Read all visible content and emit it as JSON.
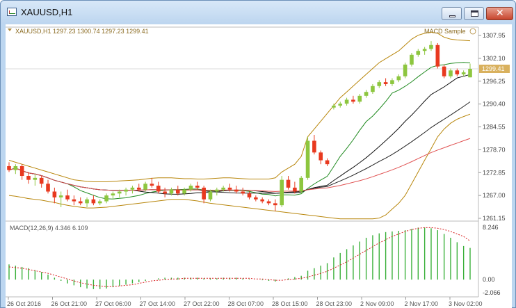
{
  "window": {
    "title": "XAUUSD,H1",
    "close_glyph": "✕",
    "icons": [
      "chart-icon",
      "minimize-icon",
      "maximize-icon",
      "close-icon"
    ]
  },
  "main_chart": {
    "header": "XAUUSD,H1  1297.23 1300.74 1297.23 1299.41",
    "indicator_label": "MACD Sample",
    "price_tag": "1299.41",
    "price_tag_color": "#d9b15e",
    "bull_color": "#8dc63f",
    "bear_color": "#e8391f",
    "band_color": "#b8860b",
    "price_axis": [
      "1307.95",
      "1302.10",
      "1296.25",
      "1290.40",
      "1284.55",
      "1278.70",
      "1272.85",
      "1267.00",
      "1261.15"
    ]
  },
  "macd": {
    "header": "MACD(12,26,9) 4.346 6.109",
    "axis": [
      "8.246",
      "0.00",
      "-2.066"
    ],
    "hist_color": "#3ab03a",
    "signal_color": "#d82020"
  },
  "time_axis": [
    "26 Oct 2016",
    "26 Oct 21:00",
    "27 Oct 06:00",
    "27 Oct 14:00",
    "27 Oct 22:00",
    "28 Oct 07:00",
    "28 Oct 15:00",
    "28 Oct 23:00",
    "2 Nov 09:00",
    "2 Nov 17:00",
    "3 Nov 02:00"
  ],
  "chart_data": {
    "type": "candlestick",
    "symbol": "XAUUSD",
    "timeframe": "H1",
    "ohlc_last": {
      "open": 1297.23,
      "high": 1300.74,
      "low": 1297.23,
      "close": 1299.41
    },
    "ylim": [
      1261.15,
      1307.95
    ],
    "candles": [
      [
        1274.5,
        1275.5,
        1273.0,
        1273.5
      ],
      [
        1273.5,
        1275.0,
        1272.5,
        1274.5
      ],
      [
        1274.5,
        1275.0,
        1271.0,
        1272.0
      ],
      [
        1272.0,
        1273.0,
        1270.0,
        1271.0
      ],
      [
        1271.0,
        1272.5,
        1269.5,
        1271.5
      ],
      [
        1271.5,
        1272.0,
        1269.0,
        1270.0
      ],
      [
        1270.0,
        1271.0,
        1267.5,
        1268.0
      ],
      [
        1268.0,
        1269.0,
        1265.0,
        1266.5
      ],
      [
        1266.5,
        1268.0,
        1264.0,
        1267.0
      ],
      [
        1267.0,
        1268.5,
        1265.5,
        1266.0
      ],
      [
        1266.0,
        1267.0,
        1264.5,
        1265.5
      ],
      [
        1265.5,
        1266.5,
        1264.5,
        1265.0
      ],
      [
        1265.0,
        1266.5,
        1264.0,
        1266.0
      ],
      [
        1266.0,
        1267.0,
        1264.5,
        1265.0
      ],
      [
        1265.0,
        1266.0,
        1264.5,
        1265.5
      ],
      [
        1265.5,
        1267.5,
        1265.0,
        1267.0
      ],
      [
        1267.0,
        1268.0,
        1266.0,
        1267.5
      ],
      [
        1267.5,
        1268.5,
        1266.5,
        1268.0
      ],
      [
        1268.0,
        1269.0,
        1267.0,
        1268.5
      ],
      [
        1268.5,
        1269.5,
        1267.5,
        1269.0
      ],
      [
        1269.0,
        1270.0,
        1268.0,
        1268.5
      ],
      [
        1268.5,
        1270.5,
        1268.0,
        1270.0
      ],
      [
        1270.0,
        1271.5,
        1269.0,
        1269.5
      ],
      [
        1269.5,
        1270.5,
        1267.5,
        1268.0
      ],
      [
        1268.0,
        1269.0,
        1266.5,
        1267.5
      ],
      [
        1267.5,
        1269.0,
        1267.0,
        1268.5
      ],
      [
        1268.5,
        1269.5,
        1267.0,
        1267.5
      ],
      [
        1267.5,
        1269.0,
        1267.0,
        1268.5
      ],
      [
        1268.5,
        1270.0,
        1268.0,
        1269.5
      ],
      [
        1269.5,
        1270.5,
        1268.5,
        1269.0
      ],
      [
        1269.0,
        1269.5,
        1265.0,
        1266.0
      ],
      [
        1266.0,
        1268.5,
        1265.5,
        1268.0
      ],
      [
        1268.0,
        1269.0,
        1267.0,
        1268.5
      ],
      [
        1268.5,
        1269.5,
        1268.0,
        1269.0
      ],
      [
        1269.0,
        1270.0,
        1268.0,
        1268.5
      ],
      [
        1268.5,
        1269.5,
        1267.5,
        1268.0
      ],
      [
        1268.0,
        1269.0,
        1267.0,
        1267.5
      ],
      [
        1267.5,
        1268.0,
        1266.0,
        1266.5
      ],
      [
        1266.5,
        1267.0,
        1265.5,
        1266.0
      ],
      [
        1266.0,
        1266.5,
        1265.0,
        1265.5
      ],
      [
        1265.5,
        1266.0,
        1264.5,
        1265.0
      ],
      [
        1265.0,
        1266.0,
        1263.0,
        1264.5
      ],
      [
        1264.5,
        1272.0,
        1264.0,
        1271.0
      ],
      [
        1271.0,
        1272.0,
        1268.5,
        1269.0
      ],
      [
        1269.0,
        1270.5,
        1267.5,
        1268.0
      ],
      [
        1268.0,
        1272.0,
        1267.5,
        1271.5
      ],
      [
        1271.5,
        1282.0,
        1271.0,
        1281.0
      ],
      [
        1281.0,
        1282.5,
        1277.5,
        1278.0
      ],
      [
        1278.0,
        1278.5,
        1275.0,
        1276.0
      ],
      [
        1276.0,
        1276.5,
        1274.5,
        1275.0
      ],
      [
        1289.5,
        1290.5,
        1289.0,
        1290.0
      ],
      [
        1290.0,
        1291.0,
        1289.5,
        1290.5
      ],
      [
        1290.5,
        1292.0,
        1290.0,
        1291.5
      ],
      [
        1291.5,
        1292.5,
        1290.5,
        1291.0
      ],
      [
        1291.0,
        1293.0,
        1290.5,
        1292.5
      ],
      [
        1292.5,
        1294.0,
        1292.0,
        1293.5
      ],
      [
        1293.5,
        1295.5,
        1293.0,
        1295.0
      ],
      [
        1295.0,
        1296.5,
        1294.5,
        1296.0
      ],
      [
        1296.0,
        1297.0,
        1295.0,
        1295.5
      ],
      [
        1295.5,
        1297.0,
        1295.0,
        1296.5
      ],
      [
        1296.5,
        1298.0,
        1296.0,
        1297.5
      ],
      [
        1297.5,
        1301.0,
        1297.0,
        1300.5
      ],
      [
        1300.5,
        1303.5,
        1300.0,
        1303.0
      ],
      [
        1303.0,
        1304.5,
        1302.5,
        1304.0
      ],
      [
        1304.0,
        1305.0,
        1303.0,
        1304.5
      ],
      [
        1304.5,
        1306.5,
        1304.0,
        1305.5
      ],
      [
        1305.5,
        1306.0,
        1299.5,
        1300.0
      ],
      [
        1300.0,
        1300.5,
        1297.0,
        1297.5
      ],
      [
        1297.5,
        1299.5,
        1297.0,
        1299.0
      ],
      [
        1299.0,
        1299.5,
        1297.5,
        1298.0
      ],
      [
        1298.0,
        1299.0,
        1297.5,
        1298.5
      ],
      [
        1297.23,
        1300.74,
        1297.23,
        1299.41
      ]
    ],
    "bollinger_upper": [
      1276,
      1275.5,
      1275,
      1274.5,
      1274,
      1273.5,
      1273,
      1272.5,
      1272,
      1271.5,
      1271,
      1270.8,
      1270.6,
      1270.5,
      1270.5,
      1270.5,
      1270.6,
      1270.7,
      1270.8,
      1270.9,
      1271,
      1271.2,
      1271.4,
      1271.5,
      1271.5,
      1271.5,
      1271.4,
      1271.3,
      1271.3,
      1271.2,
      1271.2,
      1271.3,
      1271.4,
      1271.5,
      1271.5,
      1271.4,
      1271.3,
      1271.2,
      1271.2,
      1271.2,
      1271.2,
      1271.5,
      1273,
      1274,
      1275,
      1277,
      1282,
      1284,
      1286,
      1288,
      1290,
      1292,
      1293.5,
      1295,
      1296.5,
      1298,
      1299.5,
      1301,
      1302,
      1303,
      1304,
      1305.5,
      1307,
      1308,
      1308.5,
      1308.8,
      1308.5,
      1307.5,
      1307,
      1306.8,
      1306.7,
      1306.6
    ],
    "bollinger_lower": [
      1267,
      1266.8,
      1266.5,
      1266.2,
      1266,
      1265.8,
      1265.5,
      1265.2,
      1264.8,
      1264.5,
      1264.2,
      1264,
      1263.8,
      1263.8,
      1263.9,
      1264,
      1264.2,
      1264.4,
      1264.6,
      1264.8,
      1265,
      1265.2,
      1265.4,
      1265.6,
      1265.8,
      1266,
      1266,
      1266,
      1265.8,
      1265.6,
      1265.3,
      1265,
      1264.8,
      1264.6,
      1264.4,
      1264.2,
      1264,
      1263.8,
      1263.6,
      1263.4,
      1263.2,
      1263,
      1262.8,
      1262.6,
      1262.4,
      1262.2,
      1262,
      1261.8,
      1261.6,
      1261.4,
      1261.2,
      1261,
      1261,
      1261,
      1261,
      1261,
      1261,
      1261.2,
      1262,
      1263.5,
      1265,
      1267,
      1270,
      1273,
      1276,
      1279,
      1282,
      1284,
      1285.5,
      1286.5,
      1287.2,
      1287.8
    ],
    "macd_hist": [
      2.4,
      2.2,
      2.0,
      1.8,
      1.5,
      1.2,
      0.8,
      0.3,
      -0.2,
      -0.6,
      -0.9,
      -1.2,
      -1.4,
      -1.5,
      -1.5,
      -1.4,
      -1.2,
      -1.0,
      -0.8,
      -0.6,
      -0.4,
      -0.2,
      0.0,
      0.2,
      0.3,
      0.3,
      0.3,
      0.3,
      0.3,
      0.3,
      0.2,
      0.2,
      0.2,
      0.3,
      0.3,
      0.3,
      0.2,
      0.1,
      0.0,
      -0.1,
      -0.2,
      -0.3,
      0.0,
      0.2,
      0.4,
      0.6,
      1.4,
      1.8,
      2.2,
      2.6,
      3.5,
      4.2,
      4.8,
      5.4,
      6.0,
      6.6,
      7.0,
      7.3,
      7.5,
      7.6,
      7.7,
      7.8,
      8.0,
      8.2,
      8.2,
      8.1,
      7.8,
      7.2,
      6.6,
      5.9,
      5.3,
      5.0
    ],
    "macd_signal": [
      2.0,
      1.9,
      1.8,
      1.6,
      1.4,
      1.2,
      1.0,
      0.7,
      0.4,
      0.1,
      -0.2,
      -0.5,
      -0.7,
      -0.9,
      -1.0,
      -1.1,
      -1.1,
      -1.0,
      -0.9,
      -0.8,
      -0.6,
      -0.4,
      -0.2,
      -0.1,
      0.0,
      0.1,
      0.1,
      0.2,
      0.2,
      0.2,
      0.2,
      0.2,
      0.2,
      0.2,
      0.2,
      0.2,
      0.2,
      0.2,
      0.1,
      0.1,
      0.0,
      -0.1,
      -0.1,
      0.0,
      0.1,
      0.2,
      0.4,
      0.7,
      1.0,
      1.3,
      1.8,
      2.3,
      2.8,
      3.4,
      4.0,
      4.6,
      5.2,
      5.8,
      6.3,
      6.8,
      7.2,
      7.6,
      7.9,
      8.1,
      8.2,
      8.2,
      8.1,
      7.9,
      7.6,
      7.2,
      6.8,
      6.1
    ]
  }
}
